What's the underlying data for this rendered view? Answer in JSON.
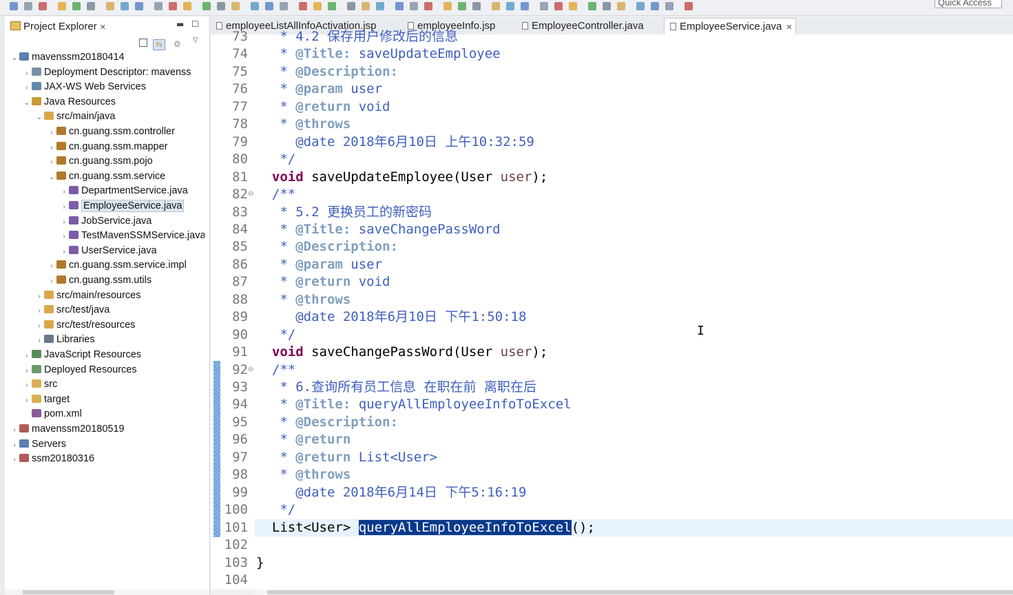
{
  "toolbar": {
    "quick_access": "Quick Access"
  },
  "project_explorer": {
    "title": "Project Explorer",
    "tree": [
      {
        "label": "mavenssm20180414",
        "depth": 0,
        "arrow": "⌄",
        "icon": "project-icon",
        "color": "#5a7fb0"
      },
      {
        "label": "Deployment Descriptor: mavenss",
        "depth": 1,
        "arrow": "›",
        "icon": "deployment-descriptor-icon",
        "color": "#7a8fa8"
      },
      {
        "label": "JAX-WS Web Services",
        "depth": 1,
        "arrow": "›",
        "icon": "webservice-icon",
        "color": "#6688aa"
      },
      {
        "label": "Java Resources",
        "depth": 1,
        "arrow": "⌄",
        "icon": "java-resources-icon",
        "color": "#c89a3a"
      },
      {
        "label": "src/main/java",
        "depth": 2,
        "arrow": "⌄",
        "icon": "source-folder-icon",
        "color": "#d8a84a"
      },
      {
        "label": "cn.guang.ssm.controller",
        "depth": 3,
        "arrow": "›",
        "icon": "package-icon",
        "color": "#b07a2a"
      },
      {
        "label": "cn.guang.ssm.mapper",
        "depth": 3,
        "arrow": "›",
        "icon": "package-icon",
        "color": "#b07a2a"
      },
      {
        "label": "cn.guang.ssm.pojo",
        "depth": 3,
        "arrow": "›",
        "icon": "package-icon",
        "color": "#b07a2a"
      },
      {
        "label": "cn.guang.ssm.service",
        "depth": 3,
        "arrow": "⌄",
        "icon": "package-icon",
        "color": "#b07a2a"
      },
      {
        "label": "DepartmentService.java",
        "depth": 4,
        "arrow": "›",
        "icon": "java-interface-icon",
        "color": "#7a5ca8"
      },
      {
        "label": "EmployeeService.java",
        "depth": 4,
        "arrow": "›",
        "icon": "java-interface-icon",
        "color": "#7a5ca8",
        "selected": true
      },
      {
        "label": "JobService.java",
        "depth": 4,
        "arrow": "›",
        "icon": "java-interface-icon",
        "color": "#7a5ca8"
      },
      {
        "label": "TestMavenSSMService.java",
        "depth": 4,
        "arrow": "›",
        "icon": "java-interface-icon",
        "color": "#7a5ca8"
      },
      {
        "label": "UserService.java",
        "depth": 4,
        "arrow": "›",
        "icon": "java-interface-icon",
        "color": "#7a5ca8"
      },
      {
        "label": "cn.guang.ssm.service.impl",
        "depth": 3,
        "arrow": "›",
        "icon": "package-icon",
        "color": "#b07a2a"
      },
      {
        "label": "cn.guang.ssm.utils",
        "depth": 3,
        "arrow": "›",
        "icon": "package-icon",
        "color": "#b07a2a"
      },
      {
        "label": "src/main/resources",
        "depth": 2,
        "arrow": "›",
        "icon": "source-folder-icon",
        "color": "#d8a84a"
      },
      {
        "label": "src/test/java",
        "depth": 2,
        "arrow": "›",
        "icon": "source-folder-icon",
        "color": "#d8a84a"
      },
      {
        "label": "src/test/resources",
        "depth": 2,
        "arrow": "›",
        "icon": "source-folder-icon",
        "color": "#d8a84a"
      },
      {
        "label": "Libraries",
        "depth": 2,
        "arrow": "›",
        "icon": "libraries-icon",
        "color": "#6a7a8a"
      },
      {
        "label": "JavaScript Resources",
        "depth": 1,
        "arrow": "›",
        "icon": "javascript-resources-icon",
        "color": "#5a8a5a"
      },
      {
        "label": "Deployed Resources",
        "depth": 1,
        "arrow": "›",
        "icon": "deployed-resources-icon",
        "color": "#6a9a6a"
      },
      {
        "label": "src",
        "depth": 1,
        "arrow": "›",
        "icon": "folder-icon",
        "color": "#d8b050"
      },
      {
        "label": "target",
        "depth": 1,
        "arrow": "›",
        "icon": "folder-icon",
        "color": "#d8b050"
      },
      {
        "label": "pom.xml",
        "depth": 1,
        "arrow": "",
        "icon": "maven-file-icon",
        "color": "#8a5a9a"
      },
      {
        "label": "mavenssm20180519",
        "depth": 0,
        "arrow": "›",
        "icon": "project-icon",
        "color": "#b05a5a"
      },
      {
        "label": "Servers",
        "depth": 0,
        "arrow": "›",
        "icon": "servers-folder-icon",
        "color": "#5a7fb0"
      },
      {
        "label": "ssm20180316",
        "depth": 0,
        "arrow": "›",
        "icon": "project-icon",
        "color": "#b05a5a"
      }
    ]
  },
  "editor": {
    "tabs": [
      {
        "label": "employeeListAllInfoActivation.jsp",
        "active": false
      },
      {
        "label": "employeeInfo.jsp",
        "active": false
      },
      {
        "label": "EmployeeController.java",
        "active": false
      },
      {
        "label": "EmployeeService.java",
        "active": true
      }
    ],
    "lines": [
      {
        "no": "73",
        "segs": [
          {
            "t": "   * ",
            "c": "c-doc"
          },
          {
            "t": "4.2 保存用户修改后的信息",
            "c": "c-doc"
          }
        ]
      },
      {
        "no": "74",
        "segs": [
          {
            "t": "   * ",
            "c": "c-doc"
          },
          {
            "t": "@Title:",
            "c": "c-tag"
          },
          {
            "t": " saveUpdateEmployee",
            "c": "c-doc"
          }
        ]
      },
      {
        "no": "75",
        "segs": [
          {
            "t": "   * ",
            "c": "c-doc"
          },
          {
            "t": "@Description:",
            "c": "c-tag"
          }
        ]
      },
      {
        "no": "76",
        "segs": [
          {
            "t": "   * ",
            "c": "c-doc"
          },
          {
            "t": "@param",
            "c": "c-tag"
          },
          {
            "t": " user",
            "c": "c-doc"
          }
        ]
      },
      {
        "no": "77",
        "segs": [
          {
            "t": "   * ",
            "c": "c-doc"
          },
          {
            "t": "@return",
            "c": "c-tag"
          },
          {
            "t": " void",
            "c": "c-doc"
          }
        ]
      },
      {
        "no": "78",
        "segs": [
          {
            "t": "   * ",
            "c": "c-doc"
          },
          {
            "t": "@throws",
            "c": "c-tag"
          }
        ]
      },
      {
        "no": "79",
        "segs": [
          {
            "t": "     @date 2018年6月10日 上午10:32:59",
            "c": "c-doc"
          }
        ]
      },
      {
        "no": "80",
        "segs": [
          {
            "t": "   */",
            "c": "c-doc"
          }
        ]
      },
      {
        "no": "81",
        "segs": [
          {
            "t": "  ",
            "c": ""
          },
          {
            "t": "void",
            "c": "c-kw"
          },
          {
            "t": " saveUpdateEmployee(User ",
            "c": ""
          },
          {
            "t": "user",
            "c": "c-param"
          },
          {
            "t": ");",
            "c": ""
          }
        ]
      },
      {
        "no": "82",
        "fold": true,
        "segs": [
          {
            "t": "  /**",
            "c": "c-doc"
          }
        ]
      },
      {
        "no": "83",
        "segs": [
          {
            "t": "   * ",
            "c": "c-doc"
          },
          {
            "t": "5.2 更换员工的新密码",
            "c": "c-doc"
          }
        ]
      },
      {
        "no": "84",
        "segs": [
          {
            "t": "   * ",
            "c": "c-doc"
          },
          {
            "t": "@Title:",
            "c": "c-tag"
          },
          {
            "t": " saveChangePassWord",
            "c": "c-doc"
          }
        ]
      },
      {
        "no": "85",
        "segs": [
          {
            "t": "   * ",
            "c": "c-doc"
          },
          {
            "t": "@Description:",
            "c": "c-tag"
          }
        ]
      },
      {
        "no": "86",
        "segs": [
          {
            "t": "   * ",
            "c": "c-doc"
          },
          {
            "t": "@param",
            "c": "c-tag"
          },
          {
            "t": " user",
            "c": "c-doc"
          }
        ]
      },
      {
        "no": "87",
        "segs": [
          {
            "t": "   * ",
            "c": "c-doc"
          },
          {
            "t": "@return",
            "c": "c-tag"
          },
          {
            "t": " void",
            "c": "c-doc"
          }
        ]
      },
      {
        "no": "88",
        "segs": [
          {
            "t": "   * ",
            "c": "c-doc"
          },
          {
            "t": "@throws",
            "c": "c-tag"
          }
        ]
      },
      {
        "no": "89",
        "segs": [
          {
            "t": "     @date 2018年6月10日 下午1:50:18",
            "c": "c-doc"
          }
        ]
      },
      {
        "no": "90",
        "segs": [
          {
            "t": "   */",
            "c": "c-doc"
          }
        ]
      },
      {
        "no": "91",
        "segs": [
          {
            "t": "  ",
            "c": ""
          },
          {
            "t": "void",
            "c": "c-kw"
          },
          {
            "t": " saveChangePassWord(User ",
            "c": ""
          },
          {
            "t": "user",
            "c": "c-param"
          },
          {
            "t": ");",
            "c": ""
          }
        ]
      },
      {
        "no": "92",
        "fold": true,
        "segs": [
          {
            "t": "  /**",
            "c": "c-doc"
          }
        ]
      },
      {
        "no": "93",
        "segs": [
          {
            "t": "   * ",
            "c": "c-doc"
          },
          {
            "t": "6.查询所有员工信息 在职在前 离职在后",
            "c": "c-doc"
          }
        ]
      },
      {
        "no": "94",
        "segs": [
          {
            "t": "   * ",
            "c": "c-doc"
          },
          {
            "t": "@Title:",
            "c": "c-tag"
          },
          {
            "t": " queryAllEmployeeInfoToExcel",
            "c": "c-doc"
          }
        ]
      },
      {
        "no": "95",
        "segs": [
          {
            "t": "   * ",
            "c": "c-doc"
          },
          {
            "t": "@Description:",
            "c": "c-tag"
          }
        ]
      },
      {
        "no": "96",
        "segs": [
          {
            "t": "   * ",
            "c": "c-doc"
          },
          {
            "t": "@return",
            "c": "c-tag"
          }
        ]
      },
      {
        "no": "97",
        "segs": [
          {
            "t": "   * ",
            "c": "c-doc"
          },
          {
            "t": "@return",
            "c": "c-tag"
          },
          {
            "t": " List<User>",
            "c": "c-doc"
          }
        ]
      },
      {
        "no": "98",
        "segs": [
          {
            "t": "   * ",
            "c": "c-doc"
          },
          {
            "t": "@throws",
            "c": "c-tag"
          }
        ]
      },
      {
        "no": "99",
        "segs": [
          {
            "t": "     @date 2018年6月14日 下午5:16:19",
            "c": "c-doc"
          }
        ]
      },
      {
        "no": "100",
        "segs": [
          {
            "t": "   */",
            "c": "c-doc"
          }
        ]
      },
      {
        "no": "101",
        "segs": [
          {
            "t": "  List<User> ",
            "c": ""
          },
          {
            "t": "queryAllEmployeeInfoToExcel",
            "c": "sel-hl"
          },
          {
            "t": "();",
            "c": ""
          }
        ]
      },
      {
        "no": "102",
        "segs": []
      },
      {
        "no": "103",
        "segs": [
          {
            "t": "}",
            "c": ""
          }
        ]
      },
      {
        "no": "104",
        "segs": []
      }
    ]
  }
}
